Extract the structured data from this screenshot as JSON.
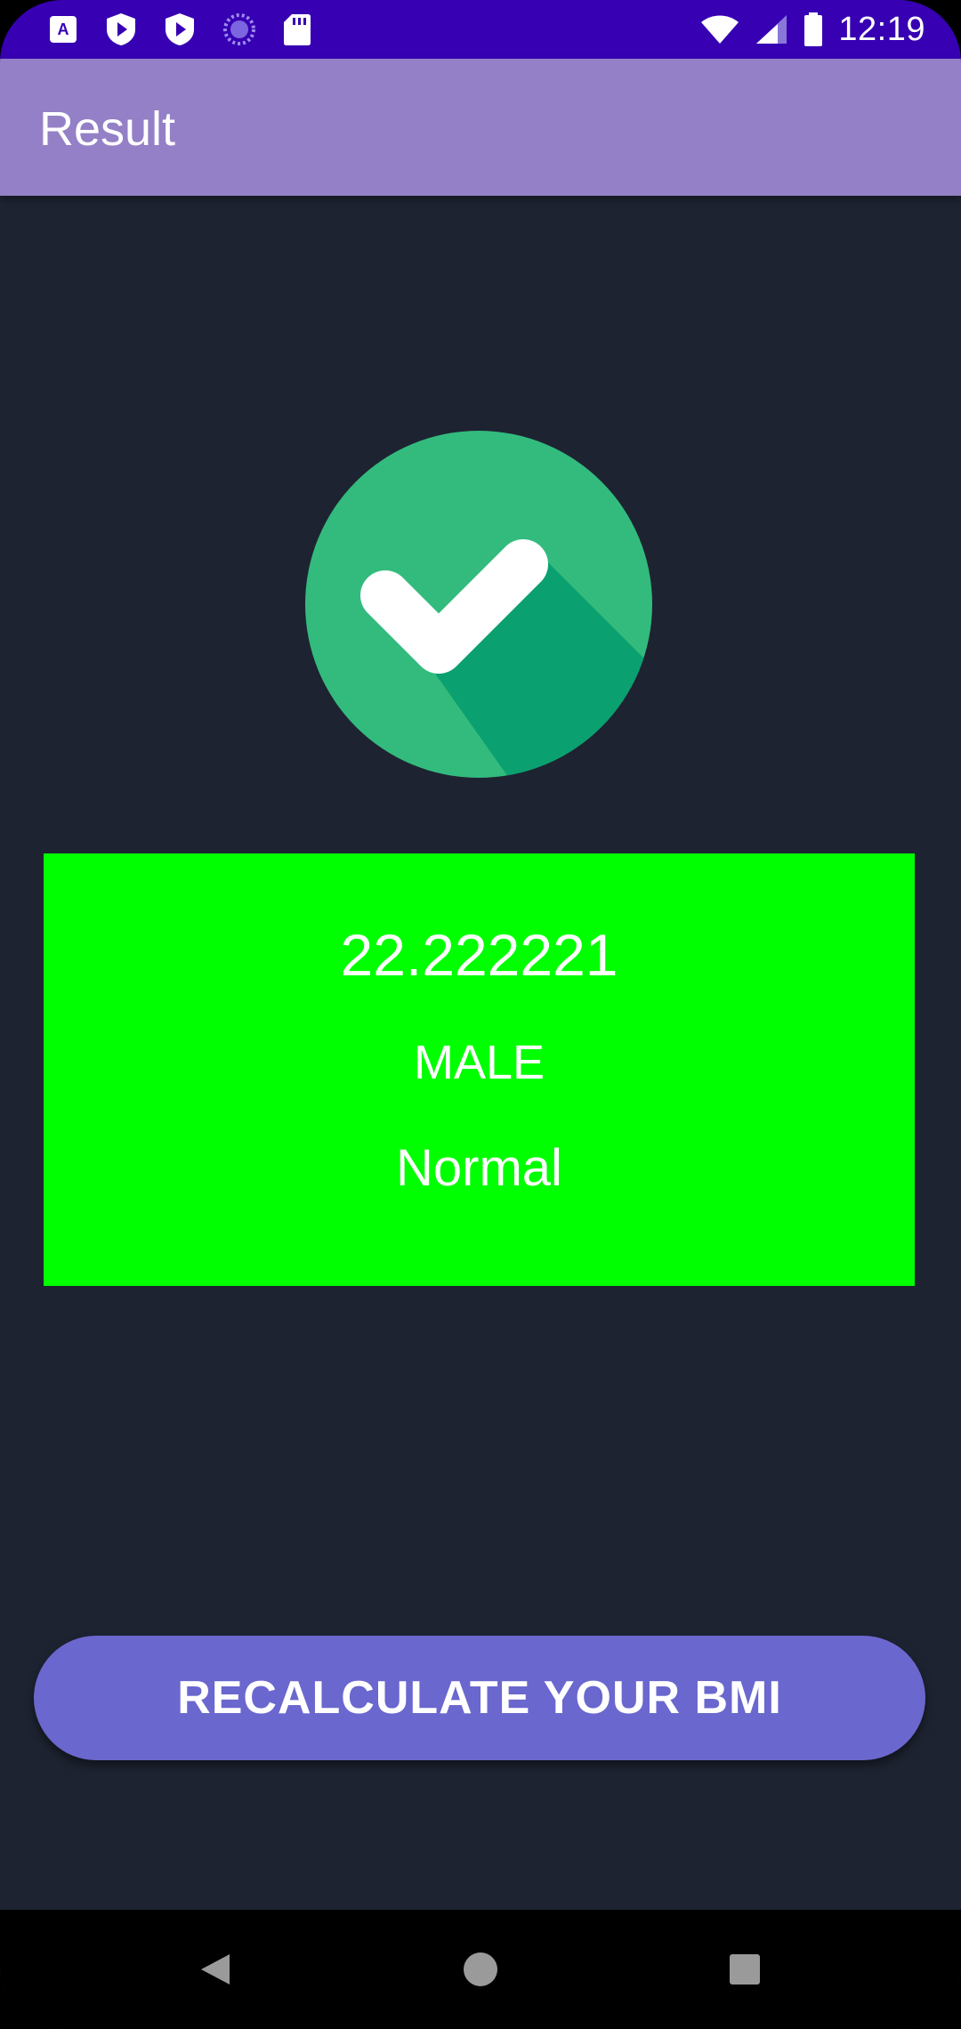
{
  "status_bar": {
    "time": "12:19",
    "left_icons": [
      "keyboard-a-icon",
      "play-shield-icon",
      "play-shield-icon",
      "loading-circle-icon",
      "sd-card-icon"
    ],
    "right_icons": [
      "wifi-icon",
      "signal-icon",
      "battery-icon"
    ]
  },
  "app_bar": {
    "title": "Result"
  },
  "result": {
    "icon": "check-circle-icon",
    "bmi_value": "22.222221",
    "gender": "MALE",
    "category": "Normal",
    "card_color": "#00ff00"
  },
  "actions": {
    "recalculate_label": "RECALCULATE YOUR BMI"
  },
  "nav_bar": {
    "buttons": [
      "back-icon",
      "home-icon",
      "recents-icon"
    ]
  },
  "colors": {
    "status_bar": "#3700b3",
    "app_bar": "#9380c6",
    "background": "#1d2331",
    "button": "#6a67ce"
  }
}
